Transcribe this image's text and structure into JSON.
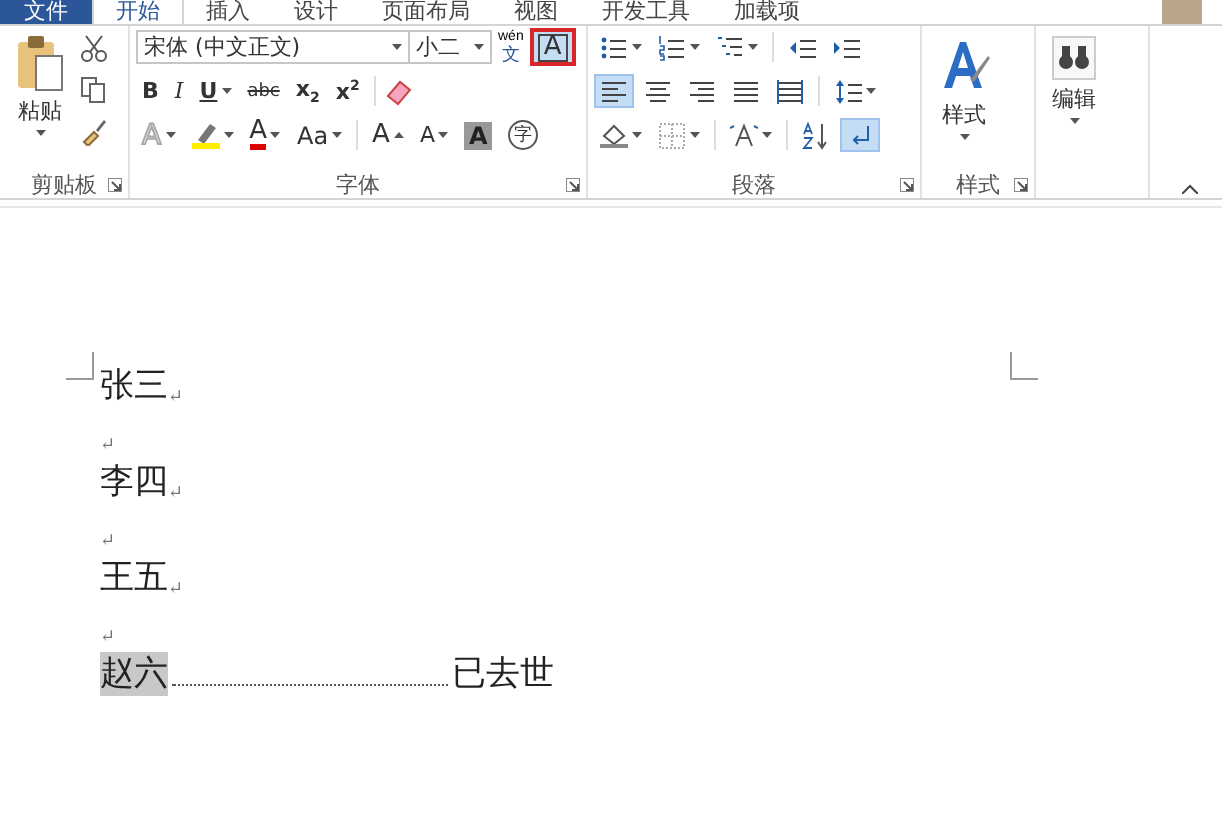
{
  "tabs": [
    {
      "label": "文件",
      "kind": "file",
      "selected": false
    },
    {
      "label": "开始",
      "kind": "tab",
      "selected": true
    },
    {
      "label": "插入",
      "kind": "tab",
      "selected": false
    },
    {
      "label": "设计",
      "kind": "tab",
      "selected": false
    },
    {
      "label": "页面布局",
      "kind": "tab",
      "selected": false
    },
    {
      "label": "视图",
      "kind": "tab",
      "selected": false
    },
    {
      "label": "开发工具",
      "kind": "tab",
      "selected": false
    },
    {
      "label": "加载项",
      "kind": "tab",
      "selected": false
    }
  ],
  "clipboard": {
    "paste_label": "粘贴",
    "group_label": "剪贴板",
    "launcher": true
  },
  "font": {
    "group_label": "字体",
    "launcher": true,
    "font_name": "宋体 (中文正文)",
    "font_size": "小二",
    "phonetic": {
      "top": "wén",
      "bottom": "文"
    },
    "char_border": {
      "text": "A",
      "selected": true,
      "annotated": true
    },
    "format_buttons": [
      {
        "kind": "bold",
        "text": "B"
      },
      {
        "kind": "italic",
        "text": "I"
      },
      {
        "kind": "underline",
        "text": "U",
        "dropdown": true
      },
      {
        "kind": "strike",
        "text": "abc"
      },
      {
        "kind": "sub",
        "text": "x$_{2}$"
      },
      {
        "kind": "sup",
        "text": "x$^{2}$"
      }
    ],
    "effect_buttons": [
      {
        "kind": "text-effect",
        "text": "A",
        "dropdown": true
      },
      {
        "kind": "highlight",
        "dropdown": true
      },
      {
        "kind": "font-color",
        "text": "A",
        "dropdown": true
      },
      {
        "kind": "case",
        "text": "Aa",
        "dropdown": true
      },
      {
        "kind": "grow",
        "text": "A"
      },
      {
        "kind": "shrink",
        "text": "A"
      },
      {
        "kind": "shading",
        "text": "A"
      },
      {
        "kind": "enclose",
        "text": "字"
      }
    ]
  },
  "paragraph": {
    "group_label": "段落",
    "launcher": true,
    "rows": [
      [
        {
          "kind": "bullets",
          "dropdown": true,
          "selected": false
        },
        {
          "kind": "numbering",
          "dropdown": true,
          "selected": false
        },
        {
          "kind": "multilevel",
          "dropdown": true,
          "selected": false
        },
        {
          "kind": "decrease-indent",
          "dropdown": false,
          "selected": false
        },
        {
          "kind": "increase-indent",
          "dropdown": false,
          "selected": false
        }
      ],
      [
        {
          "kind": "align-left",
          "dropdown": false,
          "selected": true
        },
        {
          "kind": "align-center",
          "dropdown": false,
          "selected": false
        },
        {
          "kind": "align-right",
          "dropdown": false,
          "selected": false
        },
        {
          "kind": "justify",
          "dropdown": false,
          "selected": false
        },
        {
          "kind": "distribute",
          "dropdown": false,
          "selected": false
        },
        {
          "kind": "line-spacing",
          "dropdown": true,
          "selected": false
        }
      ],
      [
        {
          "kind": "shading",
          "dropdown": true,
          "selected": false
        },
        {
          "kind": "borders",
          "dropdown": true,
          "selected": false
        },
        {
          "kind": "asian-layout",
          "dropdown": true,
          "selected": false
        },
        {
          "kind": "sort",
          "dropdown": false,
          "selected": false
        },
        {
          "kind": "show-marks",
          "dropdown": false,
          "selected": true
        }
      ]
    ]
  },
  "styles": {
    "label": "样式",
    "group_label": "样式",
    "launcher": true
  },
  "editing": {
    "label": "编辑"
  },
  "document": {
    "paragraph_mark": "↵",
    "paragraphs": [
      {
        "kind": "text",
        "text": "张三",
        "highlighted": false
      },
      {
        "kind": "empty"
      },
      {
        "kind": "text",
        "text": "李四",
        "highlighted": false
      },
      {
        "kind": "empty"
      },
      {
        "kind": "text",
        "text": "王五",
        "highlighted": false
      },
      {
        "kind": "empty"
      },
      {
        "kind": "tabbed",
        "text": "赵六",
        "highlighted": true,
        "after": "已去世"
      }
    ]
  }
}
